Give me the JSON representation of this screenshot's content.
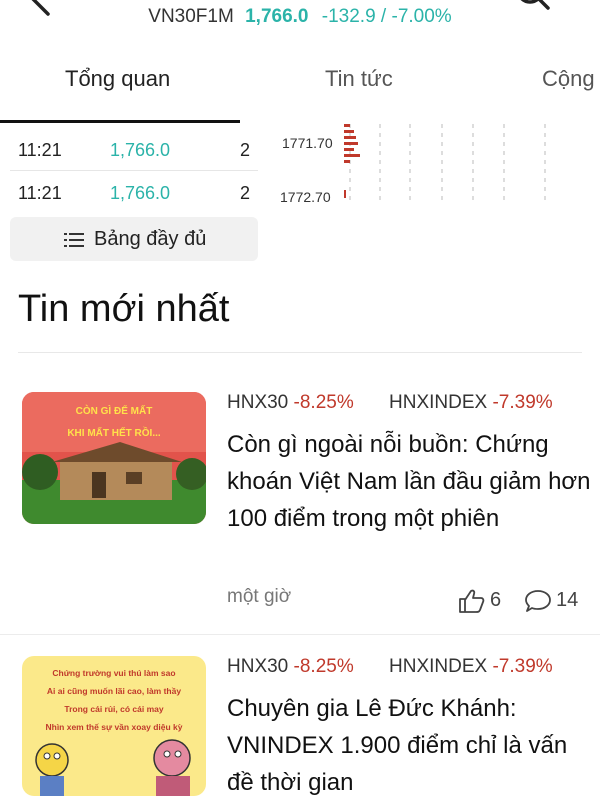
{
  "header": {
    "symbol": "VN30F1M",
    "price": "1,766.0",
    "change": "-132.9 / -7.00%",
    "accent_color": "#2bb3a9"
  },
  "tabs": [
    {
      "label": "Tổng quan",
      "active": true
    },
    {
      "label": "Tin tức",
      "active": false
    },
    {
      "label": "Cộng",
      "active": false
    }
  ],
  "trades": [
    {
      "time": "11:21",
      "price": "1,766.0",
      "volume": "2"
    },
    {
      "time": "11:21",
      "price": "1,766.0",
      "volume": "2"
    }
  ],
  "order_book": {
    "levels": [
      "1771.70",
      "1772.70"
    ]
  },
  "full_table_label": "Bảng đầy đủ",
  "section_title": "Tin mới nhất",
  "news": [
    {
      "tag1_name": "HNX30",
      "tag1_value": "-8.25%",
      "tag2_name": "HNXINDEX",
      "tag2_value": "-7.39%",
      "title": "Còn gì ngoài nỗi buồn: Chứng khoán Việt Nam lần đầu giảm hơn 100 điểm trong một phiên",
      "time": "một giờ",
      "likes": "6",
      "comments": "14",
      "thumbnail_caption_1": "CÒN GÌ ĐỂ MẤT",
      "thumbnail_caption_2": "KHI MẤT HẾT RỒI..."
    },
    {
      "tag1_name": "HNX30",
      "tag1_value": "-8.25%",
      "tag2_name": "HNXINDEX",
      "tag2_value": "-7.39%",
      "title": "Chuyên gia Lê Đức Khánh: VNINDEX 1.900 điểm chỉ là vấn đề thời gian",
      "thumbnail_lines": [
        "Chứng trường vui thú làm sao",
        "Ai ai cũng muốn lãi cao, làm thầy",
        "Trong cái rủi, có cái may",
        "Nhìn xem thế sự vần xoay diệu kỳ"
      ]
    }
  ],
  "colors": {
    "up": "#2bb3a9",
    "down": "#c0392b",
    "orderbook_bar": "#c0392b"
  }
}
